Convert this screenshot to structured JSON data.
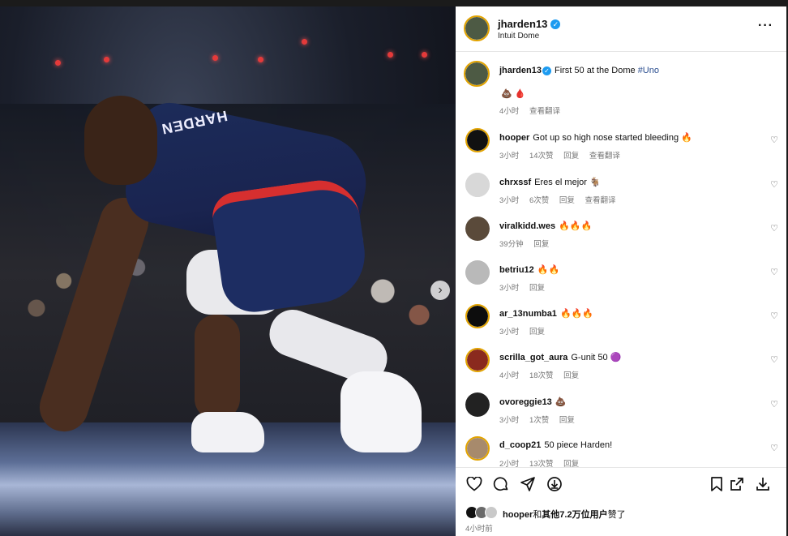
{
  "post": {
    "username": "jharden13",
    "location": "Intuit Dome",
    "caption_text": "First 50 at the Dome",
    "caption_tag": "#Uno",
    "caption_emojis": "💩 🩸",
    "caption_time": "4小时",
    "caption_translate": "查看翻译",
    "jersey_text": "HARDEN"
  },
  "comments": [
    {
      "user": "hooper",
      "text": "Got up so high nose started bleeding 🔥",
      "time": "3小时",
      "likes": "14次赞",
      "reply": "回复",
      "translate": "查看翻译",
      "avatar_color": "#111111"
    },
    {
      "user": "chrxssf",
      "text": "Eres el mejor 🐐",
      "time": "3小时",
      "likes": "6次赞",
      "reply": "回复",
      "translate": "查看翻译",
      "avatar_color": "#d8d8d8"
    },
    {
      "user": "viralkidd.wes",
      "text": "🔥🔥🔥",
      "time": "39分钟",
      "likes": "",
      "reply": "回复",
      "translate": "",
      "avatar_color": "#5a4a3a"
    },
    {
      "user": "betriu12",
      "text": "🔥🔥",
      "time": "3小时",
      "likes": "",
      "reply": "回复",
      "translate": "",
      "avatar_color": "#b9b9b9"
    },
    {
      "user": "ar_13numba1",
      "text": "🔥🔥🔥",
      "time": "3小时",
      "likes": "",
      "reply": "回复",
      "translate": "",
      "avatar_color": "#0d0d0d"
    },
    {
      "user": "scrilla_got_aura",
      "text": "G-unit 50 🟣",
      "time": "4小时",
      "likes": "18次赞",
      "reply": "回复",
      "translate": "",
      "avatar_color": "#8a2a1e"
    },
    {
      "user": "ovoreggie13",
      "text": "💩",
      "time": "3小时",
      "likes": "1次赞",
      "reply": "回复",
      "translate": "",
      "avatar_color": "#222222"
    },
    {
      "user": "d_coop21",
      "text": "50 piece Harden!",
      "time": "2小时",
      "likes": "13次赞",
      "reply": "回复",
      "translate": "",
      "avatar_color": "#a78a6c"
    }
  ],
  "actions": {
    "like_icon": "heart-icon",
    "comment_icon": "comment-icon",
    "share_icon": "send-icon",
    "remix_icon": "arrow-circle-icon",
    "save_icon": "bookmark-icon",
    "external_icon": "external-link-icon",
    "download_icon": "download-icon"
  },
  "likes_summary": {
    "user": "hooper",
    "middle": "和",
    "rest": "其他7.2万位用户",
    "suffix": "赞了"
  },
  "timestamp": "4小时前",
  "colors": {
    "verified": "#1d9bf0",
    "story_ring": "#e2a300",
    "hashtag": "#2a4d8f"
  }
}
